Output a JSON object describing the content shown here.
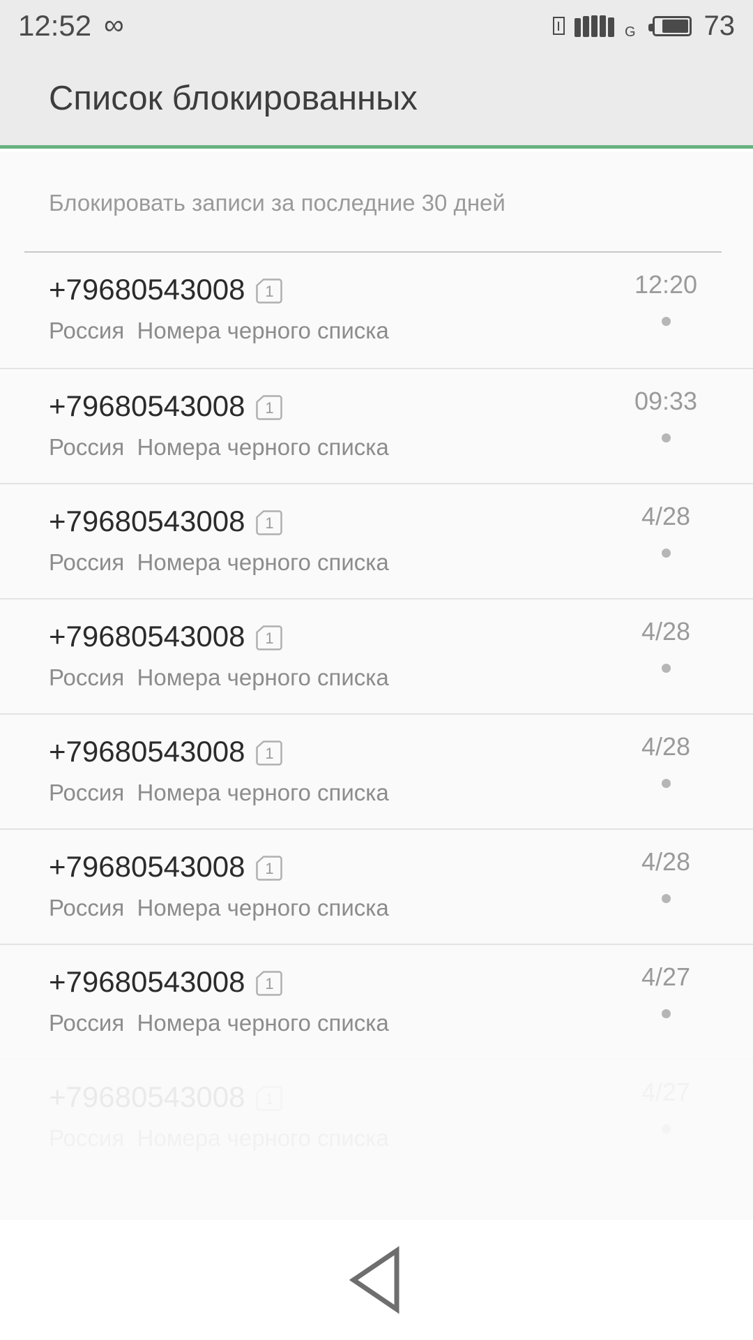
{
  "status_bar": {
    "clock": "12:52",
    "infinity_glyph": "∞",
    "sim_slot_icon": "sim-slot-icon",
    "signal_icon": "signal-bars-icon",
    "signal_bar_count": 5,
    "network_type": "G",
    "battery_icon": "battery-icon",
    "battery_level_percent": 73,
    "battery_percent_label": "73",
    "icon_color": "#4a4a4a",
    "background": "#ebebeb"
  },
  "header": {
    "title": "Список блокированных",
    "background": "#ebebeb",
    "accent_color": "#68b180"
  },
  "list": {
    "subtitle": "Блокировать записи за последние 30 дней",
    "background": "#fafafa",
    "divider_color": "#e3e3e3",
    "rows": [
      {
        "number": "+79680543008",
        "sim_badge": "1",
        "subtitle": "Россия  Номера черного списка",
        "time": "12:20"
      },
      {
        "number": "+79680543008",
        "sim_badge": "1",
        "subtitle": "Россия  Номера черного списка",
        "time": "09:33"
      },
      {
        "number": "+79680543008",
        "sim_badge": "1",
        "subtitle": "Россия  Номера черного списка",
        "time": "4/28"
      },
      {
        "number": "+79680543008",
        "sim_badge": "1",
        "subtitle": "Россия  Номера черного списка",
        "time": "4/28"
      },
      {
        "number": "+79680543008",
        "sim_badge": "1",
        "subtitle": "Россия  Номера черного списка",
        "time": "4/28"
      },
      {
        "number": "+79680543008",
        "sim_badge": "1",
        "subtitle": "Россия  Номера черного списка",
        "time": "4/28"
      },
      {
        "number": "+79680543008",
        "sim_badge": "1",
        "subtitle": "Россия  Номера черного списка",
        "time": "4/27"
      },
      {
        "number": "+79680543008",
        "sim_badge": "1",
        "subtitle": "Россия  Номера черного списка",
        "time": "4/27"
      }
    ]
  },
  "nav_bar": {
    "back_icon": "back-triangle-icon",
    "icon_color": "#6e6e6e",
    "background": "#ffffff"
  }
}
